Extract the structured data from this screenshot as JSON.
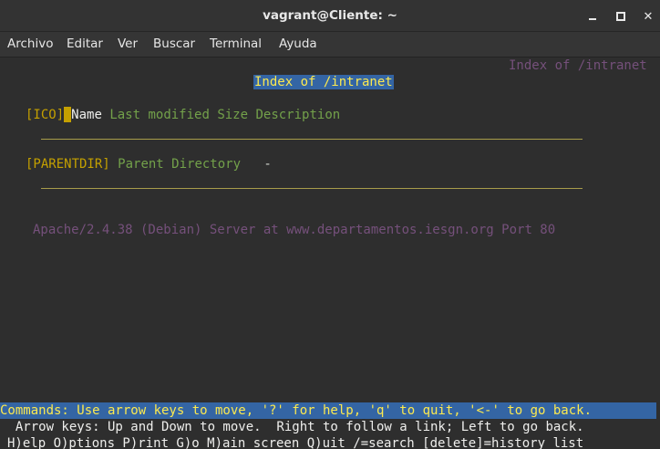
{
  "window": {
    "title": "vagrant@Cliente: ~",
    "minimize_icon": "minimize-icon",
    "maximize_icon": "maximize-icon",
    "close_icon": "close-icon",
    "close_glyph": "✕"
  },
  "menubar": {
    "items": [
      "Archivo",
      "Editar",
      "Ver",
      "Buscar",
      "Terminal",
      "Ayuda"
    ]
  },
  "terminal": {
    "top_right_title": "Index of /intranet",
    "heading": "Index of /intranet",
    "columns_line": {
      "ico": "[ICO]",
      "name": "Name",
      "rest": "Last modified Size Description"
    },
    "parent_line": {
      "tag": "[PARENTDIR]",
      "link": "Parent Directory",
      "dash": "-"
    },
    "server_signature": "Apache/2.4.38 (Debian) Server at www.departamentos.iesgn.org Port 80",
    "commands_bar": "Commands: Use arrow keys to move, '?' for help, 'q' to quit, '<-' to go back.",
    "help_line_1": "  Arrow keys: Up and Down to move.  Right to follow a link; Left to go back.",
    "help_line_2": "H)elp O)ptions P)rint G)o M)ain screen Q)uit /=search [delete]=history list"
  },
  "colors": {
    "heading_bg": "#3465a4",
    "heading_fg": "#fce94f",
    "tag": "#c4a000",
    "link": "#73a14a",
    "signature": "#75507b"
  }
}
